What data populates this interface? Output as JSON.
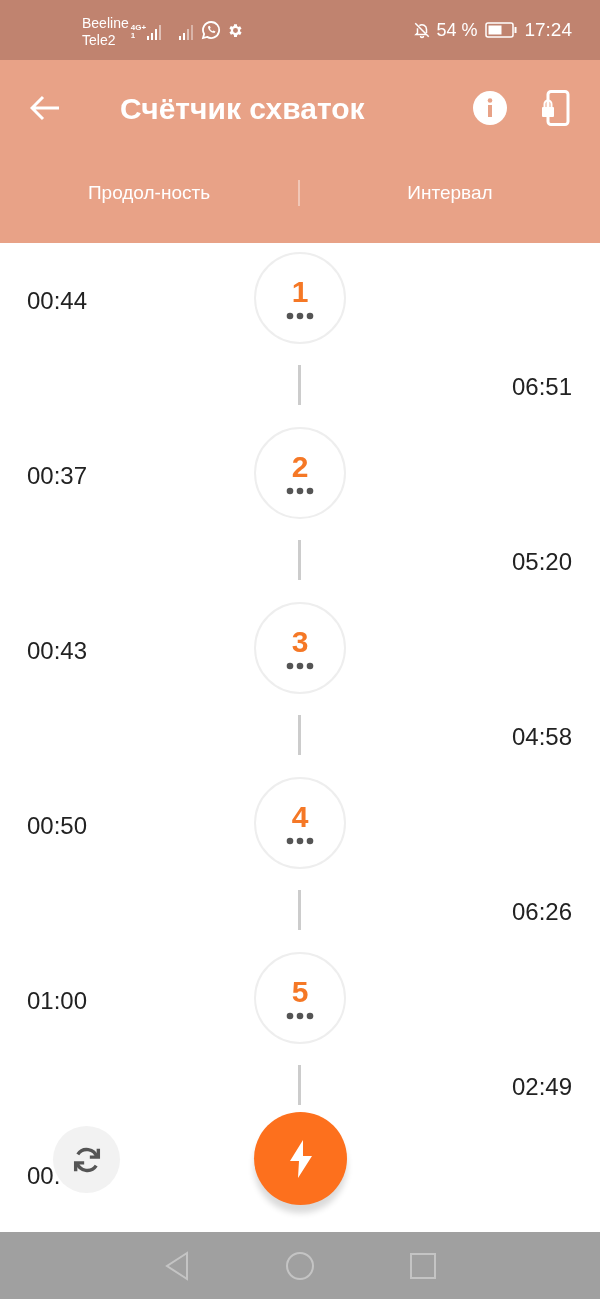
{
  "status_bar": {
    "carriers": [
      "Beeline",
      "Tele2"
    ],
    "network": "4G+",
    "sim": "1",
    "battery": "54 %",
    "time": "17:24"
  },
  "header": {
    "title": "Счётчик схваток"
  },
  "columns": [
    "Продол-ность",
    "Интервал"
  ],
  "contractions": [
    {
      "number": "1",
      "duration": "00:44",
      "interval": "06:51"
    },
    {
      "number": "2",
      "duration": "00:37",
      "interval": "05:20"
    },
    {
      "number": "3",
      "duration": "00:43",
      "interval": "04:58"
    },
    {
      "number": "4",
      "duration": "00:50",
      "interval": "06:26"
    },
    {
      "number": "5",
      "duration": "01:00",
      "interval": "02:49"
    },
    {
      "duration": "00."
    }
  ]
}
